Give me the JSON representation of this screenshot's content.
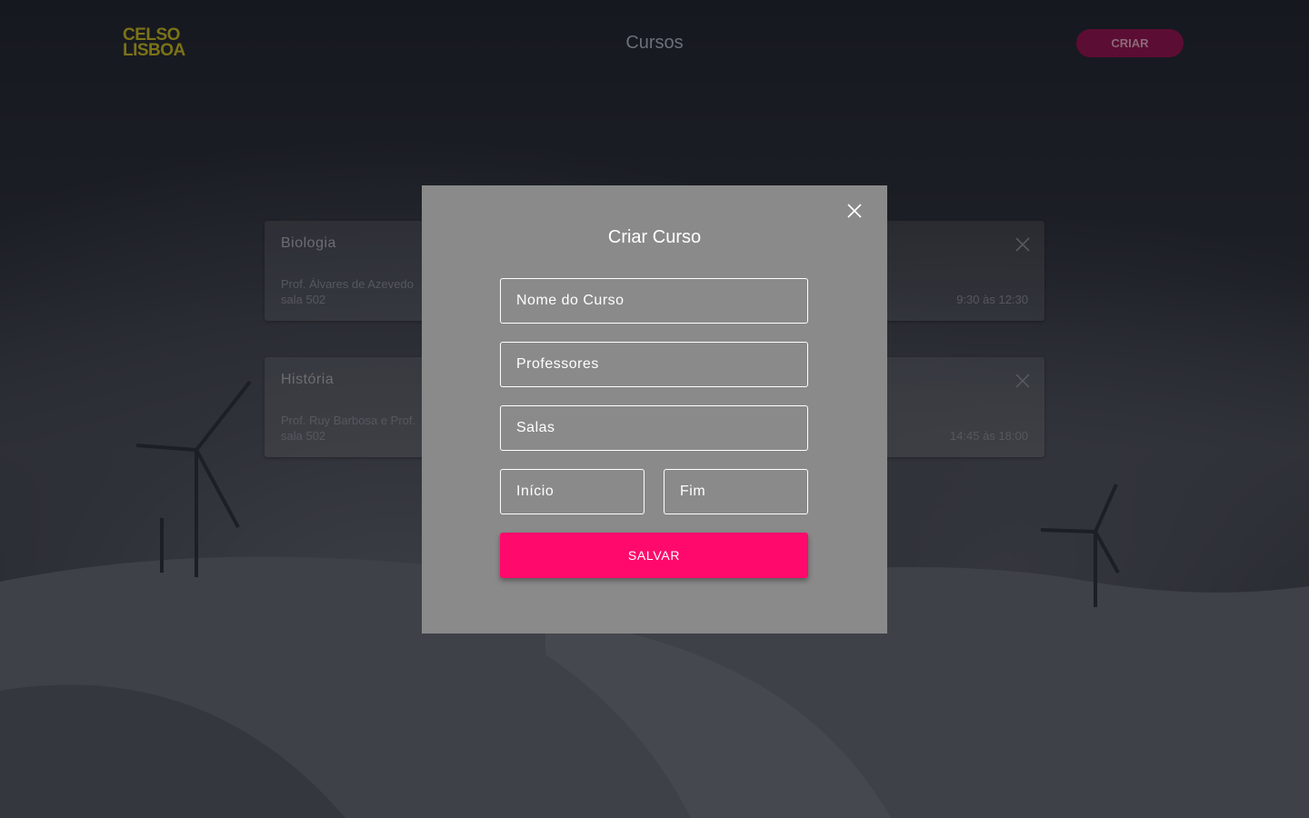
{
  "header": {
    "logo_line1": "CELSO",
    "logo_line2": "LISBOA",
    "title": "Cursos",
    "create_label": "CRIAR"
  },
  "courses": [
    {
      "title": "Biologia",
      "professors": "Prof. Álvares de Azevedo",
      "room": "sala 502",
      "time": "9:30 às 12:30",
      "close_icon": "close-icon"
    },
    {
      "title": "História",
      "professors": "Prof. Ruy Barbosa e Prof.",
      "room": "sala 502",
      "time": "14:45 às 18:00",
      "close_icon": "close-icon"
    }
  ],
  "modal": {
    "title": "Criar Curso",
    "close_icon": "close-icon",
    "fields": {
      "name_placeholder": "Nome do Curso",
      "professors_placeholder": "Professores",
      "rooms_placeholder": "Salas",
      "start_placeholder": "Início",
      "end_placeholder": "Fim"
    },
    "save_label": "SALVAR"
  },
  "colors": {
    "accent": "#ff0a6c",
    "modal_bg": "#8a8a8a",
    "logo": "#7b7317"
  }
}
